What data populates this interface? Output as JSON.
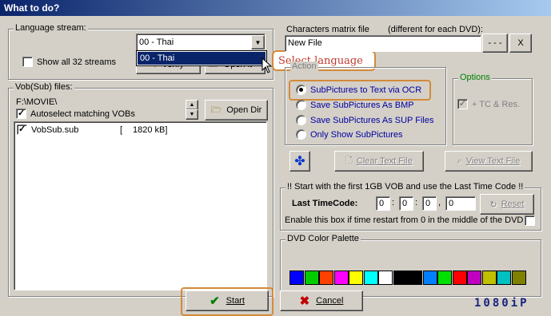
{
  "window": {
    "title": "What to do?"
  },
  "language": {
    "group_label": "Language stream:",
    "selected": "00 - Thai",
    "dropdown_item": "00 - Thai",
    "show_all_label": "Show all 32 streams",
    "verify_label": "Verify",
    "open_label": "Open it"
  },
  "callout": {
    "text": "Select language"
  },
  "vob": {
    "group_label": "Vob(Sub) files:",
    "path": "F:\\MOVIE\\",
    "autoselect_label": "Autoselect matching VOBs",
    "open_dir_label": "Open Dir",
    "files": [
      {
        "name": "VobSub.sub",
        "size_open": "[",
        "size": "1820 kB]"
      }
    ]
  },
  "matrix": {
    "label": "Characters matrix file",
    "note": "(different for each DVD):",
    "value": "New File",
    "browse_label": "- - -",
    "clear_label": "X"
  },
  "actions": {
    "group_label": "Action",
    "options": [
      "SubPictures to Text via OCR",
      "Save SubPictures As BMP",
      "Save SubPictures As SUP Files",
      "Only Show SubPictures"
    ],
    "selected_index": 0
  },
  "options": {
    "group_label": "Options",
    "tc_label": "+ TC & Res."
  },
  "buttons": {
    "clear_text": "Clear Text File",
    "view_text": "View Text File"
  },
  "timecode": {
    "group_label": "!! Start with the first 1GB VOB and use the Last Time Code !!",
    "label": "Last TimeCode:",
    "values": [
      "0",
      "0",
      "0",
      "0"
    ],
    "separators": [
      ":",
      ":",
      ","
    ],
    "reset_label": "Reset",
    "restart_label": "Enable this box if time restart from 0 in the middle of the DVD"
  },
  "palette": {
    "group_label": "DVD Color Palette",
    "colors": [
      "#0000ff",
      "#00cc00",
      "#ff4000",
      "#ff00ff",
      "#ffff00",
      "#00ffff",
      "#ffffff",
      "#000000",
      "#000000",
      "#0080ff",
      "#00e000",
      "#ff0000",
      "#c000c0",
      "#c0c000",
      "#00c0c0",
      "#808000"
    ]
  },
  "footer": {
    "start_label": "Start",
    "cancel_label": "Cancel",
    "watermark": "1080iP"
  }
}
